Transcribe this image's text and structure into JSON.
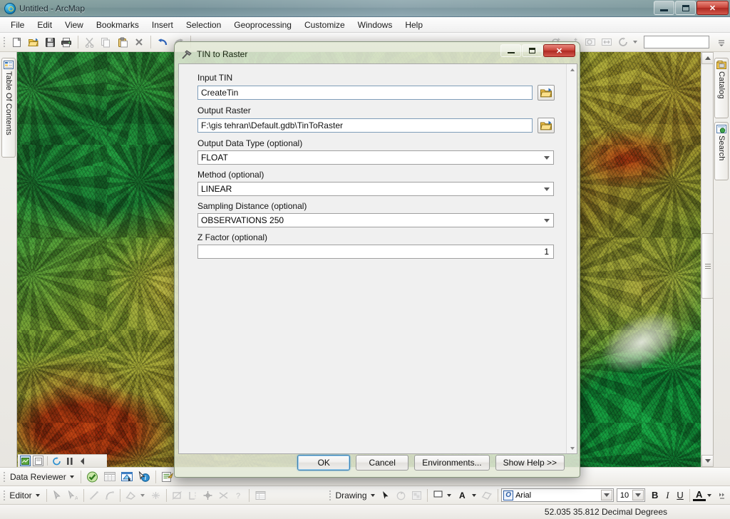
{
  "window": {
    "title": "Untitled - ArcMap",
    "app_icon": "arcmap-globe-icon",
    "minimize_label": "Minimize",
    "restore_label": "Restore",
    "close_label": "✕"
  },
  "menubar": {
    "items": [
      {
        "label": "File",
        "name": "menu-file"
      },
      {
        "label": "Edit",
        "name": "menu-edit"
      },
      {
        "label": "View",
        "name": "menu-view"
      },
      {
        "label": "Bookmarks",
        "name": "menu-bookmarks"
      },
      {
        "label": "Insert",
        "name": "menu-insert"
      },
      {
        "label": "Selection",
        "name": "menu-selection"
      },
      {
        "label": "Geoprocessing",
        "name": "menu-geoprocessing"
      },
      {
        "label": "Customize",
        "name": "menu-customize"
      },
      {
        "label": "Windows",
        "name": "menu-windows"
      },
      {
        "label": "Help",
        "name": "menu-help"
      }
    ]
  },
  "standard_toolbar": {
    "buttons": [
      {
        "icon": "new-document-icon",
        "tip": "New"
      },
      {
        "icon": "open-folder-icon",
        "tip": "Open"
      },
      {
        "icon": "save-icon",
        "tip": "Save"
      },
      {
        "icon": "print-icon",
        "tip": "Print"
      },
      {
        "icon": "cut-scissors-icon",
        "tip": "Cut"
      },
      {
        "icon": "copy-icon",
        "tip": "Copy"
      },
      {
        "icon": "paste-icon",
        "tip": "Paste"
      },
      {
        "icon": "delete-x-icon",
        "tip": "Delete"
      },
      {
        "icon": "undo-arrow-icon",
        "tip": "Undo"
      },
      {
        "icon": "redo-arrow-icon",
        "tip": "Redo"
      }
    ],
    "scale_value": "",
    "scale_placeholder": ""
  },
  "panels": {
    "left_tab": {
      "label": "Table Of Contents",
      "icon": "table-of-contents-icon"
    },
    "right_tabs": [
      {
        "label": "Catalog",
        "icon": "catalog-icon"
      },
      {
        "label": "Search",
        "icon": "search-icon"
      }
    ]
  },
  "map": {
    "view_buttons": [
      {
        "name": "data-view-button",
        "icon": "data-view-icon",
        "selected": true
      },
      {
        "name": "layout-view-button",
        "icon": "layout-view-icon",
        "selected": false
      }
    ],
    "refresh_icon": "refresh-icon",
    "pause_icon": "pause-drawing-icon",
    "colors": {
      "high_elevation": "#b83c10",
      "mid_elevation": "#a09a32",
      "low_elevation": "#1f7a33",
      "snow": "#e9ece2"
    }
  },
  "reviewer_toolbar": {
    "menu_label": "Data Reviewer",
    "buttons": [
      {
        "icon": "reviewer-session-icon"
      },
      {
        "icon": "reviewer-table-icon"
      },
      {
        "icon": "reviewer-select-icon"
      },
      {
        "icon": "reviewer-info-icon"
      },
      {
        "icon": "reviewer-batch-icon"
      }
    ]
  },
  "editor_toolbar": {
    "menu_label": "Editor",
    "buttons": [
      {
        "icon": "edit-tool-icon"
      },
      {
        "icon": "edit-annotation-icon"
      },
      {
        "icon": "straight-segment-icon"
      },
      {
        "icon": "curve-segment-icon"
      },
      {
        "icon": "construction-tool-icon"
      },
      {
        "icon": "topology-edit-icon"
      },
      {
        "icon": "cut-polygon-icon"
      },
      {
        "icon": "split-icon"
      },
      {
        "icon": "rotate-icon"
      },
      {
        "icon": "merge-icon"
      },
      {
        "icon": "undo-edit-icon"
      },
      {
        "icon": "attributes-table-icon"
      }
    ]
  },
  "drawing_toolbar": {
    "menu_label": "Drawing",
    "select_icon": "arrow-select-icon",
    "rotate_icon": "rotate-element-icon",
    "group_icon": "group-elements-icon",
    "fill_icon": "fill-color-icon",
    "text_icon": "font-color-icon",
    "shape_icon": "new-polygon-icon",
    "font_family": "Arial",
    "font_size": "10",
    "bold_label": "B",
    "italic_label": "I",
    "underline_label": "U",
    "font_color_label": "A"
  },
  "statusbar": {
    "coordinates": "52.035  35.812 Decimal Degrees"
  },
  "dialog": {
    "title": "TIN to Raster",
    "icon": "geoprocessing-tool-icon",
    "minimize_label": "Minimize",
    "restore_label": "Restore",
    "close_label": "✕",
    "fields": [
      {
        "name": "input-tin",
        "label": "Input TIN",
        "value": "CreateTin",
        "type": "text-browse",
        "browse_icon": "folder-browse-icon"
      },
      {
        "name": "output-raster",
        "label": "Output Raster",
        "value": "F:\\gis tehran\\Default.gdb\\TinToRaster",
        "type": "text-browse",
        "browse_icon": "folder-browse-icon"
      },
      {
        "name": "output-data-type",
        "label": "Output Data Type (optional)",
        "value": "FLOAT",
        "type": "select"
      },
      {
        "name": "method",
        "label": "Method (optional)",
        "value": "LINEAR",
        "type": "select"
      },
      {
        "name": "sampling-distance",
        "label": "Sampling Distance (optional)",
        "value": "OBSERVATIONS 250",
        "type": "select"
      },
      {
        "name": "z-factor",
        "label": "Z Factor (optional)",
        "value": "1",
        "type": "number"
      }
    ],
    "buttons": [
      {
        "name": "ok-button",
        "label": "OK",
        "primary": true
      },
      {
        "name": "cancel-button",
        "label": "Cancel",
        "primary": false
      },
      {
        "name": "environments-button",
        "label": "Environments...",
        "primary": false
      },
      {
        "name": "show-help-button",
        "label": "Show Help >>",
        "primary": false
      }
    ]
  }
}
